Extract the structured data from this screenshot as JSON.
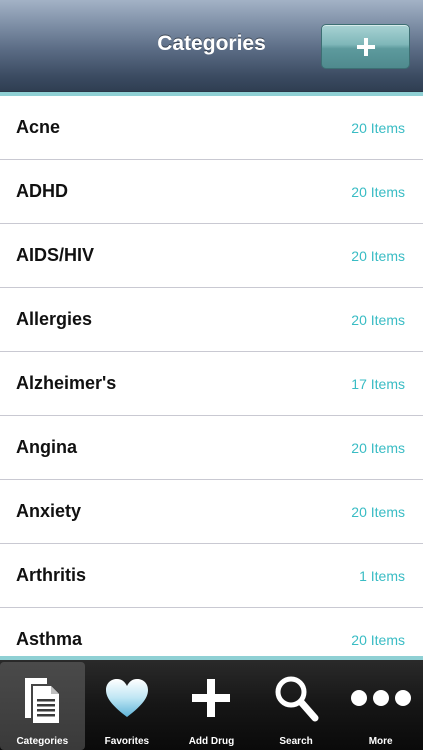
{
  "navbar": {
    "title": "Categories",
    "add_icon": "plus-icon"
  },
  "categories": [
    {
      "name": "Acne",
      "count": "20 Items"
    },
    {
      "name": "ADHD",
      "count": "20 Items"
    },
    {
      "name": "AIDS/HIV",
      "count": "20 Items"
    },
    {
      "name": "Allergies",
      "count": "20 Items"
    },
    {
      "name": "Alzheimer's",
      "count": "17 Items"
    },
    {
      "name": "Angina",
      "count": "20 Items"
    },
    {
      "name": "Anxiety",
      "count": "20 Items"
    },
    {
      "name": "Arthritis",
      "count": "1 Items"
    },
    {
      "name": "Asthma",
      "count": "20 Items"
    }
  ],
  "tabs": [
    {
      "label": "Categories",
      "icon": "documents-icon",
      "active": true
    },
    {
      "label": "Favorites",
      "icon": "heart-icon",
      "active": false
    },
    {
      "label": "Add Drug",
      "icon": "plus-icon",
      "active": false
    },
    {
      "label": "Search",
      "icon": "magnifier-icon",
      "active": false
    },
    {
      "label": "More",
      "icon": "more-dots-icon",
      "active": false
    }
  ],
  "colors": {
    "accent": "#8fd0d4",
    "count_text": "#39bcc4",
    "navbar_dark": "#3a4a60"
  }
}
